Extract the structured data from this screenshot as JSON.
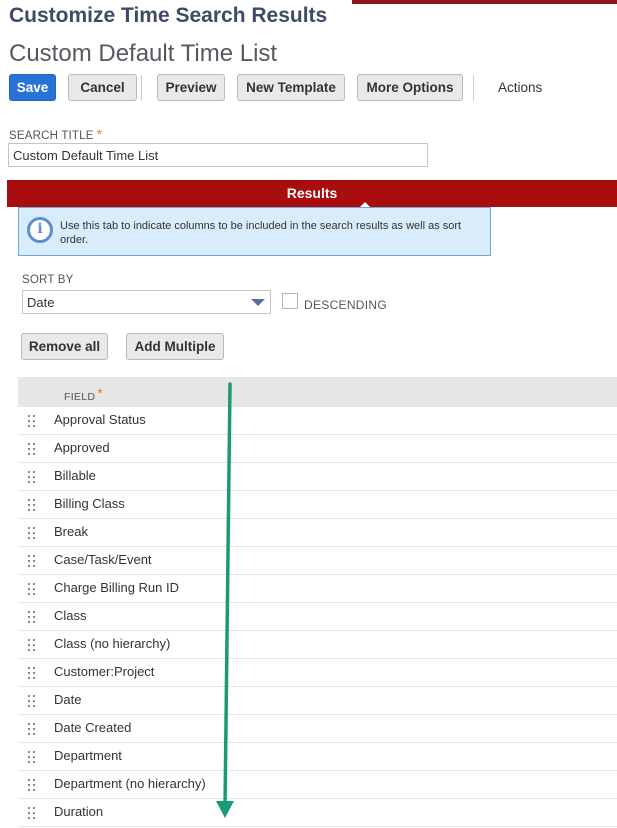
{
  "page": {
    "heading": "Customize Time Search Results",
    "record_title": "Custom Default Time List"
  },
  "toolbar": {
    "save_label": "Save",
    "cancel_label": "Cancel",
    "preview_label": "Preview",
    "new_template_label": "New Template",
    "more_options_label": "More Options",
    "actions_label": "Actions"
  },
  "search_title": {
    "label": "SEARCH TITLE",
    "required_mark": "*",
    "value": "Custom Default Time List"
  },
  "tab": {
    "label": "Results"
  },
  "info": {
    "icon": "info-icon",
    "text": "Use this tab to indicate columns to be included in the search results as well as sort order."
  },
  "sort": {
    "label": "SORT BY",
    "selected": "Date",
    "descending_label": "DESCENDING",
    "descending_checked": false
  },
  "list_buttons": {
    "remove_all_label": "Remove all",
    "add_multiple_label": "Add Multiple"
  },
  "field_table": {
    "header": "FIELD",
    "required_mark": "*",
    "rows": [
      "Approval Status",
      "Approved",
      "Billable",
      "Billing Class",
      "Break",
      "Case/Task/Event",
      "Charge Billing Run ID",
      "Class",
      "Class (no hierarchy)",
      "Customer:Project",
      "Date",
      "Date Created",
      "Department",
      "Department (no hierarchy)",
      "Duration"
    ]
  },
  "colors": {
    "primary_button": "#2a73d6",
    "tab_bar": "#aa0d0d",
    "heading": "#3f4a66",
    "info_bg": "#d9ecfb",
    "arrow": "#1a9b78"
  }
}
